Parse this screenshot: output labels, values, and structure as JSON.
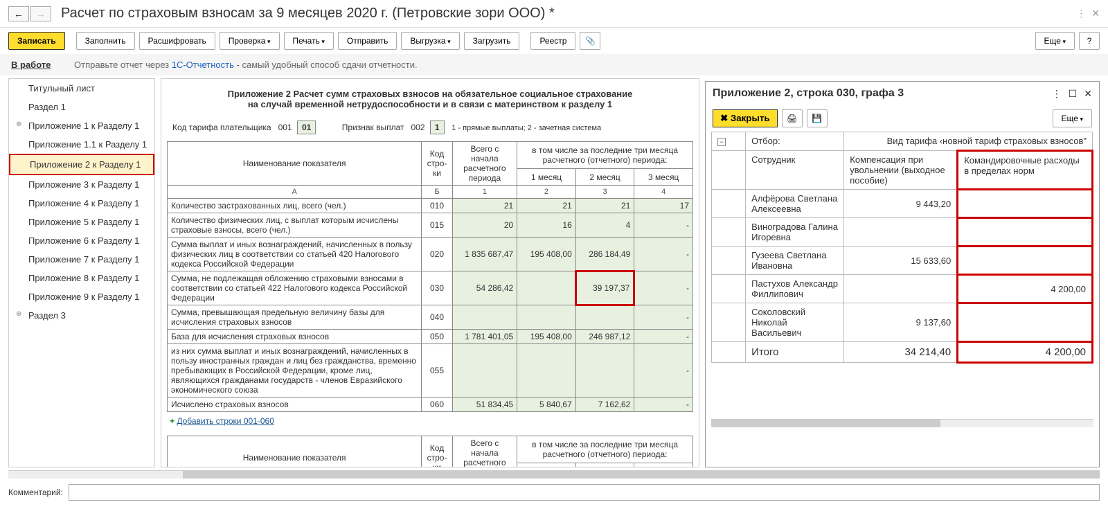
{
  "title": "Расчет по страховым взносам за 9 месяцев 2020 г. (Петровские зори ООО) *",
  "toolbar": {
    "save": "Записать",
    "fill": "Заполнить",
    "decode": "Расшифровать",
    "check": "Проверка",
    "print": "Печать",
    "send": "Отправить",
    "export": "Выгрузка",
    "load": "Загрузить",
    "registry": "Реестр",
    "more": "Еще"
  },
  "status": {
    "label": "В работе",
    "text_pre": "Отправьте отчет через ",
    "link": "1С-Отчетность",
    "text_post": " - самый удобный способ сдачи отчетности."
  },
  "sidebar": [
    "Титульный лист",
    "Раздел 1",
    "Приложение 1 к Разделу 1",
    "Приложение 1.1 к Разделу 1",
    "Приложение 2 к Разделу 1",
    "Приложение 3 к Разделу 1",
    "Приложение 4 к Разделу 1",
    "Приложение 5 к Разделу 1",
    "Приложение 6 к Разделу 1",
    "Приложение 7 к Разделу 1",
    "Приложение 8 к Разделу 1",
    "Приложение 9 к Разделу 1",
    "Раздел 3"
  ],
  "form": {
    "title1": "Приложение 2 Расчет сумм страховых взносов на обязательное социальное страхование",
    "title2": "на случай временной нетрудоспособности и в связи с материнством к разделу 1",
    "tariff_label": "Код тарифа плательщика",
    "tariff_code1": "001",
    "tariff_code2": "01",
    "pay_label": "Признак выплат",
    "pay_code1": "002",
    "pay_code2": "1",
    "pay_hint": "1 - прямые выплаты; 2 - зачетная система",
    "hdr_name": "Наименование показателя",
    "hdr_code": "Код стро-ки",
    "hdr_total": "Всего с начала расчетного периода",
    "hdr_last3": "в том числе за последние три месяца расчетного (отчетного) периода:",
    "hdr_m1": "1 месяц",
    "hdr_m2": "2 месяц",
    "hdr_m3": "3 месяц",
    "sub_a": "А",
    "sub_b": "Б",
    "sub_1": "1",
    "sub_2": "2",
    "sub_3": "3",
    "sub_4": "4",
    "rows": [
      {
        "name": "Количество застрахованных лиц, всего (чел.)",
        "code": "010",
        "v1": "21",
        "v2": "21",
        "v3": "21",
        "v4": "17"
      },
      {
        "name": "Количество физических лиц, с выплат которым исчислены страховые взносы, всего (чел.)",
        "code": "015",
        "v1": "20",
        "v2": "16",
        "v3": "4",
        "v4": "-"
      },
      {
        "name": "Сумма выплат и иных вознаграждений, начисленных в пользу физических лиц в соответствии со статьей 420 Налогового кодекса Российской Федерации",
        "code": "020",
        "v1": "1 835 687,47",
        "v2": "195 408,00",
        "v3": "286 184,49",
        "v4": "-"
      },
      {
        "name": "Сумма, не подлежащая обложению страховыми взносами в соответствии со статьей 422 Налогового кодекса Российской Федерации",
        "code": "030",
        "v1": "54 286,42",
        "v2": "",
        "v3": "39 197,37",
        "v4": "-",
        "hl": 3
      },
      {
        "name": "Сумма, превышающая предельную величину базы для исчисления страховых взносов",
        "code": "040",
        "v1": "",
        "v2": "",
        "v3": "",
        "v4": "-"
      },
      {
        "name": "База для исчисления страховых взносов",
        "code": "050",
        "v1": "1 781 401,05",
        "v2": "195 408,00",
        "v3": "246 987,12",
        "v4": "-"
      },
      {
        "name": "из них сумма выплат и иных вознаграждений, начисленных в пользу иностранных граждан и лиц без гражданства, временно пребывающих в Российской Федерации, кроме лиц, являющихся гражданами государств - членов Евразийского экономического союза",
        "code": "055",
        "v1": "",
        "v2": "",
        "v3": "",
        "v4": "-"
      },
      {
        "name": "Исчислено страховых взносов",
        "code": "060",
        "v1": "51 834,45",
        "v2": "5 840,67",
        "v3": "7 162,62",
        "v4": "-"
      }
    ],
    "add_link": "Добавить строки 001-060"
  },
  "panel": {
    "title": "Приложение 2, строка 030, графа 3",
    "close": "Закрыть",
    "more": "Еще",
    "filter_label": "Отбор:",
    "filter_text": "Вид тарифа ‹новной тариф страховых взносов\"",
    "col_emp": "Сотрудник",
    "col_comp": "Компенсация при увольнении (выходное пособие)",
    "col_trip": "Командировочные расходы в пределах норм",
    "rows": [
      {
        "name": "Алфёрова Светлана Алексеевна",
        "c1": "9 443,20",
        "c2": ""
      },
      {
        "name": "Виноградова Галина Игоревна",
        "c1": "",
        "c2": ""
      },
      {
        "name": "Гузеева Светлана Ивановна",
        "c1": "15 633,60",
        "c2": ""
      },
      {
        "name": "Пастухов Александр Филлипович",
        "c1": "",
        "c2": "4 200,00"
      },
      {
        "name": "Соколовский Николай Васильевич",
        "c1": "9 137,60",
        "c2": ""
      }
    ],
    "total_label": "Итого",
    "total_c1": "34 214,40",
    "total_c2": "4 200,00"
  },
  "footer": {
    "comment": "Комментарий:"
  }
}
